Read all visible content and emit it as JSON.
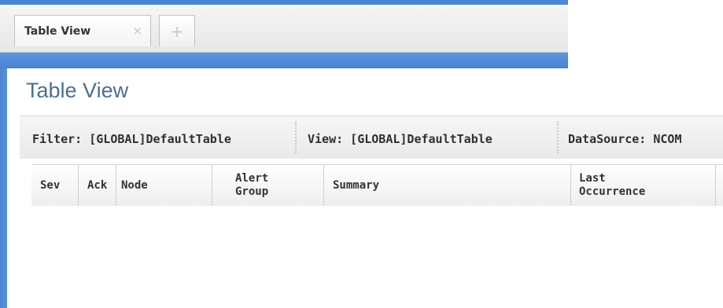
{
  "tabs": [
    {
      "label": "Table View",
      "close": "×"
    }
  ],
  "add_tab_icon": "+",
  "page_title": "Table View",
  "toolbar": {
    "filter": "Filter: [GLOBAL]DefaultTable",
    "view": "View: [GLOBAL]DefaultTable",
    "datasource": "DataSource: NCOM"
  },
  "columns": [
    {
      "label": "Sev"
    },
    {
      "label": "Ack"
    },
    {
      "label": "Node"
    },
    {
      "label": "Alert\nGroup"
    },
    {
      "label": "Summary"
    },
    {
      "label": "Last\nOccurrence"
    }
  ],
  "colors": {
    "accent_blue": "#4a86d4",
    "title_color": "#4c6f92"
  }
}
